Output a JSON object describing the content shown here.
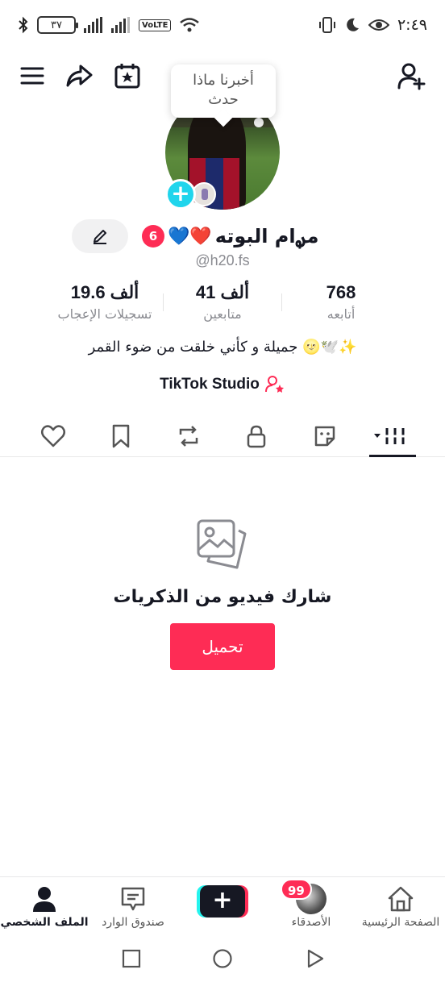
{
  "status_bar": {
    "time": "٢:٤٩",
    "battery": "٣٧",
    "volte": "VoLTE"
  },
  "tooltip": {
    "line1": "أخبرنا ماذا",
    "line2": "حدث"
  },
  "profile": {
    "display_name": "مࢪام البوته",
    "name_emojis": "💙❤️",
    "notification_count": "6",
    "username": "@h20.fs",
    "bio": "جميلة و كأني خلقت من ضوء القمر 🌝🕊️✨"
  },
  "stats": {
    "following": {
      "value": "768",
      "label": "أتابعه"
    },
    "followers": {
      "value": "41 ألف",
      "label": "متابعين"
    },
    "likes": {
      "value": "19.6 ألف",
      "label": "تسجيلات الإعجاب"
    }
  },
  "studio": {
    "label": "TikTok Studio"
  },
  "empty_state": {
    "title": "شارك فيديو من الذكريات",
    "button_label": "تحميل"
  },
  "bottom_nav": {
    "home": "الصفحة الرئيسية",
    "friends": "الأصدقاء",
    "friends_badge": "99",
    "inbox": "صندوق الوارد",
    "profile": "الملف الشخصي"
  },
  "colors": {
    "accent": "#fe2c55",
    "cyan": "#25f4ee",
    "text": "#161823",
    "muted": "#8a8b91"
  }
}
